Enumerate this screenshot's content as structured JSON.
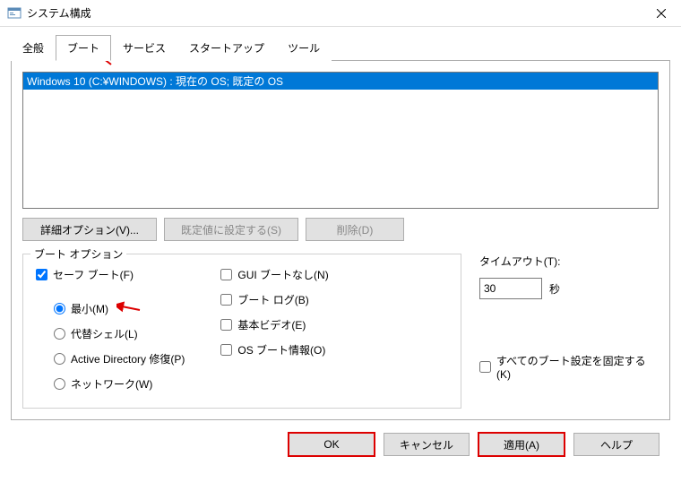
{
  "window": {
    "title": "システム構成"
  },
  "tabs": {
    "general": "全般",
    "boot": "ブート",
    "services": "サービス",
    "startup": "スタートアップ",
    "tools": "ツール"
  },
  "boot_list": {
    "item0": "Windows 10 (C:¥WINDOWS) : 現在の OS; 既定の OS"
  },
  "buttons": {
    "advanced": "詳細オプション(V)...",
    "set_default": "既定値に設定する(S)",
    "delete": "削除(D)"
  },
  "group": {
    "title": "ブート オプション"
  },
  "options": {
    "safe_boot": "セーフ ブート(F)",
    "minimal": "最小(M)",
    "alt_shell": "代替シェル(L)",
    "ad_repair": "Active Directory 修復(P)",
    "network": "ネットワーク(W)",
    "no_gui": "GUI ブートなし(N)",
    "boot_log": "ブート ログ(B)",
    "base_video": "基本ビデオ(E)",
    "os_boot_info": "OS ブート情報(O)"
  },
  "timeout": {
    "label": "タイムアウト(T):",
    "value": "30",
    "unit": "秒"
  },
  "fix_settings": "すべてのブート設定を固定する(K)",
  "dialog": {
    "ok": "OK",
    "cancel": "キャンセル",
    "apply": "適用(A)",
    "help": "ヘルプ"
  }
}
